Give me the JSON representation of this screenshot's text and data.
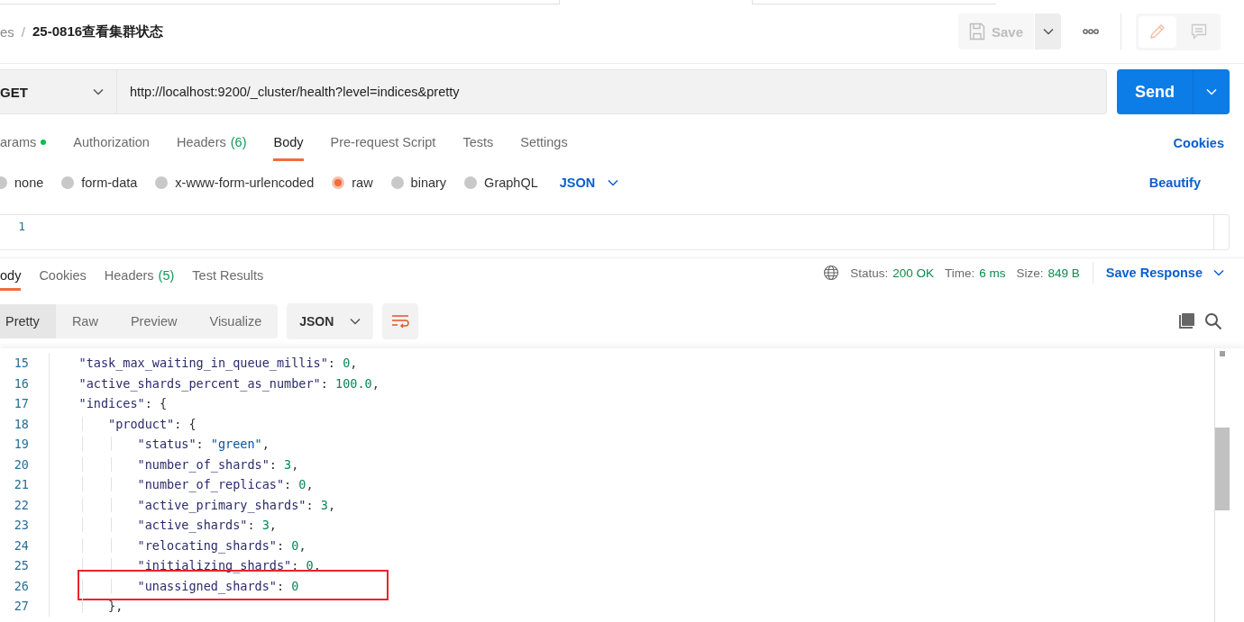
{
  "breadcrumb": {
    "parent": "es",
    "separator": "/",
    "title": "25-0816查看集群状态"
  },
  "save_button": {
    "label": "Save",
    "disabled": true
  },
  "request": {
    "method": "GET",
    "url": "http://localhost:9200/_cluster/health?level=indices&pretty"
  },
  "send_button": {
    "label": "Send"
  },
  "request_tabs": [
    {
      "label": "arams",
      "indicator": true,
      "selected": false
    },
    {
      "label": "Authorization",
      "indicator": false,
      "selected": false
    },
    {
      "label": "Headers",
      "count": "(6)",
      "indicator": false,
      "selected": false
    },
    {
      "label": "Body",
      "indicator": false,
      "selected": true
    },
    {
      "label": "Pre-request Script",
      "indicator": false,
      "selected": false
    },
    {
      "label": "Tests",
      "indicator": false,
      "selected": false
    },
    {
      "label": "Settings",
      "indicator": false,
      "selected": false
    }
  ],
  "cookies_link": "Cookies",
  "body_types": [
    {
      "label": "none",
      "selected": false
    },
    {
      "label": "form-data",
      "selected": false
    },
    {
      "label": "x-www-form-urlencoded",
      "selected": false
    },
    {
      "label": "raw",
      "selected": true
    },
    {
      "label": "binary",
      "selected": false
    },
    {
      "label": "GraphQL",
      "selected": false
    }
  ],
  "body_format": "JSON",
  "beautify_link": "Beautify",
  "editor": {
    "line_numbers": [
      "1"
    ]
  },
  "response_tabs": [
    {
      "label": "ody",
      "selected": true
    },
    {
      "label": "Cookies",
      "selected": false
    },
    {
      "label": "Headers",
      "count": "(5)",
      "selected": false
    },
    {
      "label": "Test Results",
      "selected": false
    }
  ],
  "response_meta": [
    {
      "label": "Status:",
      "value": "200 OK"
    },
    {
      "label": "Time:",
      "value": "6 ms"
    },
    {
      "label": "Size:",
      "value": "849 B"
    }
  ],
  "save_response": "Save Response",
  "view_modes": [
    {
      "label": "Pretty",
      "selected": true
    },
    {
      "label": "Raw",
      "selected": false
    },
    {
      "label": "Preview",
      "selected": false
    },
    {
      "label": "Visualize",
      "selected": false
    }
  ],
  "view_format": "JSON",
  "code_lines": [
    {
      "number": "15",
      "highlighted": false,
      "tokens": [
        {
          "kind": "key",
          "text": "    \"task_max_waiting_in_queue_millis\""
        },
        {
          "kind": "punct",
          "text": ": "
        },
        {
          "kind": "number",
          "text": "0"
        },
        {
          "kind": "punct",
          "text": ","
        }
      ]
    },
    {
      "number": "16",
      "highlighted": false,
      "tokens": [
        {
          "kind": "key",
          "text": "    \"active_shards_percent_as_number\""
        },
        {
          "kind": "punct",
          "text": ": "
        },
        {
          "kind": "number",
          "text": "100.0"
        },
        {
          "kind": "punct",
          "text": ","
        }
      ]
    },
    {
      "number": "17",
      "highlighted": false,
      "tokens": [
        {
          "kind": "key",
          "text": "    \"indices\""
        },
        {
          "kind": "punct",
          "text": ": {"
        }
      ]
    },
    {
      "number": "18",
      "highlighted": false,
      "tokens": [
        {
          "kind": "key",
          "text": "        \"product\""
        },
        {
          "kind": "punct",
          "text": ": {"
        }
      ]
    },
    {
      "number": "19",
      "highlighted": false,
      "tokens": [
        {
          "kind": "key",
          "text": "            \"status\""
        },
        {
          "kind": "punct",
          "text": ": "
        },
        {
          "kind": "string",
          "text": "\"green\""
        },
        {
          "kind": "punct",
          "text": ","
        }
      ]
    },
    {
      "number": "20",
      "highlighted": false,
      "tokens": [
        {
          "kind": "key",
          "text": "            \"number_of_shards\""
        },
        {
          "kind": "punct",
          "text": ": "
        },
        {
          "kind": "number",
          "text": "3"
        },
        {
          "kind": "punct",
          "text": ","
        }
      ]
    },
    {
      "number": "21",
      "highlighted": false,
      "tokens": [
        {
          "kind": "key",
          "text": "            \"number_of_replicas\""
        },
        {
          "kind": "punct",
          "text": ": "
        },
        {
          "kind": "number",
          "text": "0"
        },
        {
          "kind": "punct",
          "text": ","
        }
      ]
    },
    {
      "number": "22",
      "highlighted": false,
      "tokens": [
        {
          "kind": "key",
          "text": "            \"active_primary_shards\""
        },
        {
          "kind": "punct",
          "text": ": "
        },
        {
          "kind": "number",
          "text": "3"
        },
        {
          "kind": "punct",
          "text": ","
        }
      ]
    },
    {
      "number": "23",
      "highlighted": false,
      "tokens": [
        {
          "kind": "key",
          "text": "            \"active_shards\""
        },
        {
          "kind": "punct",
          "text": ": "
        },
        {
          "kind": "number",
          "text": "3"
        },
        {
          "kind": "punct",
          "text": ","
        }
      ]
    },
    {
      "number": "24",
      "highlighted": false,
      "tokens": [
        {
          "kind": "key",
          "text": "            \"relocating_shards\""
        },
        {
          "kind": "punct",
          "text": ": "
        },
        {
          "kind": "number",
          "text": "0"
        },
        {
          "kind": "punct",
          "text": ","
        }
      ]
    },
    {
      "number": "25",
      "highlighted": false,
      "tokens": [
        {
          "kind": "key",
          "text": "            \"initializing_shards\""
        },
        {
          "kind": "punct",
          "text": ": "
        },
        {
          "kind": "number",
          "text": "0"
        },
        {
          "kind": "punct",
          "text": ","
        }
      ]
    },
    {
      "number": "26",
      "highlighted": true,
      "tokens": [
        {
          "kind": "key",
          "text": "            \"unassigned_shards\""
        },
        {
          "kind": "punct",
          "text": ": "
        },
        {
          "kind": "number",
          "text": "0"
        }
      ]
    },
    {
      "number": "27",
      "highlighted": false,
      "tokens": [
        {
          "kind": "punct",
          "text": "        },"
        }
      ]
    }
  ]
}
